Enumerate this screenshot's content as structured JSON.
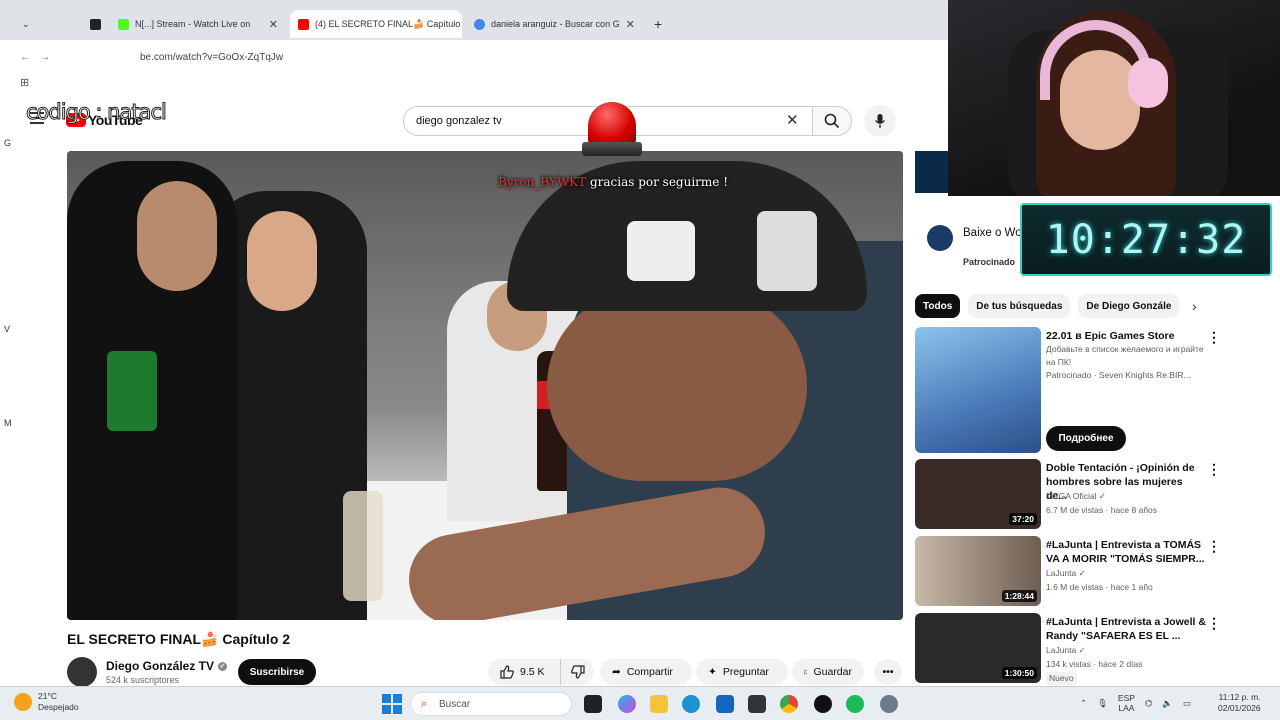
{
  "browser": {
    "tabs": [
      {
        "label": "",
        "active": false
      },
      {
        "label": "N[...] Stream - Watch Live on",
        "active": false
      },
      {
        "label": "(4) EL SECRETO FINAL🍰 Capítulo",
        "active": true
      },
      {
        "label": "daniela aranguiz - Buscar con G",
        "active": false
      }
    ],
    "new_tab": "+",
    "url": "be.com/watch?v=GoOx-ZqTqJw"
  },
  "overlay": {
    "stream_text": "codigo : natacl",
    "alert_user": "Byron_BYWKT",
    "alert_msg": " gracias por seguirme !",
    "clock": "10:27:32"
  },
  "youtube": {
    "logo_text": "YouTube",
    "search_value": "diego gonzalez tv",
    "video": {
      "title": "EL SECRETO FINAL🍰 Capítulo 2",
      "channel": "Diego González TV",
      "subscribers": "524 k suscriptores",
      "subscribe_label": "Suscribirse",
      "likes": "9.5 K",
      "share_label": "Compartir",
      "ask_label": "Preguntar",
      "save_label": "Guardar",
      "more_label": "•••"
    },
    "ad": {
      "title": "Baixe o Wo[...] Warships",
      "sponsored": "Patrocinado"
    },
    "chips": [
      "Todos",
      "De tus búsquedas",
      "De Diego Gonzále"
    ],
    "recommendations": [
      {
        "title": "22.01 в Epic Games Store",
        "line2": "Добавьте в список желаемого и играйте на ПК!",
        "channel": "Patrocinado · Seven Knights Re:BIR...",
        "cta": "Подробнее",
        "thumb_color": "#6aa2d6"
      },
      {
        "title": "Doble Tentación - ¡Opinión de hombres sobre las mujeres de...",
        "channel": "MEGA Oficial",
        "stats": "6.7 M de vistas · hace 8 años",
        "duration": "37:20",
        "thumb_color": "#3a2b28"
      },
      {
        "title": "#LaJunta | Entrevista a TOMÁS VA A MORIR \"TOMÁS SIEMPR...",
        "channel": "LaJunta",
        "stats": "1.6 M de vistas · hace 1 año",
        "duration": "1:28:44",
        "thumb_color": "#7b6a5e"
      },
      {
        "title": "#LaJunta | Entrevista a Jowell & Randy \"SAFAERA ES EL ...",
        "channel": "LaJunta",
        "stats": "134 k vistas · hace 2 días",
        "badge": "Nuevo",
        "duration": "1:30:50",
        "thumb_color": "#2a2a2a"
      }
    ]
  },
  "taskbar": {
    "weather_temp": "21°C",
    "weather_desc": "Despejado",
    "search_placeholder": "Buscar",
    "lang_top": "ESP",
    "lang_bottom": "LAA",
    "time": "11:12 p. m.",
    "date": "02/01/2026"
  },
  "side_letters": [
    "G",
    "V",
    "M"
  ]
}
